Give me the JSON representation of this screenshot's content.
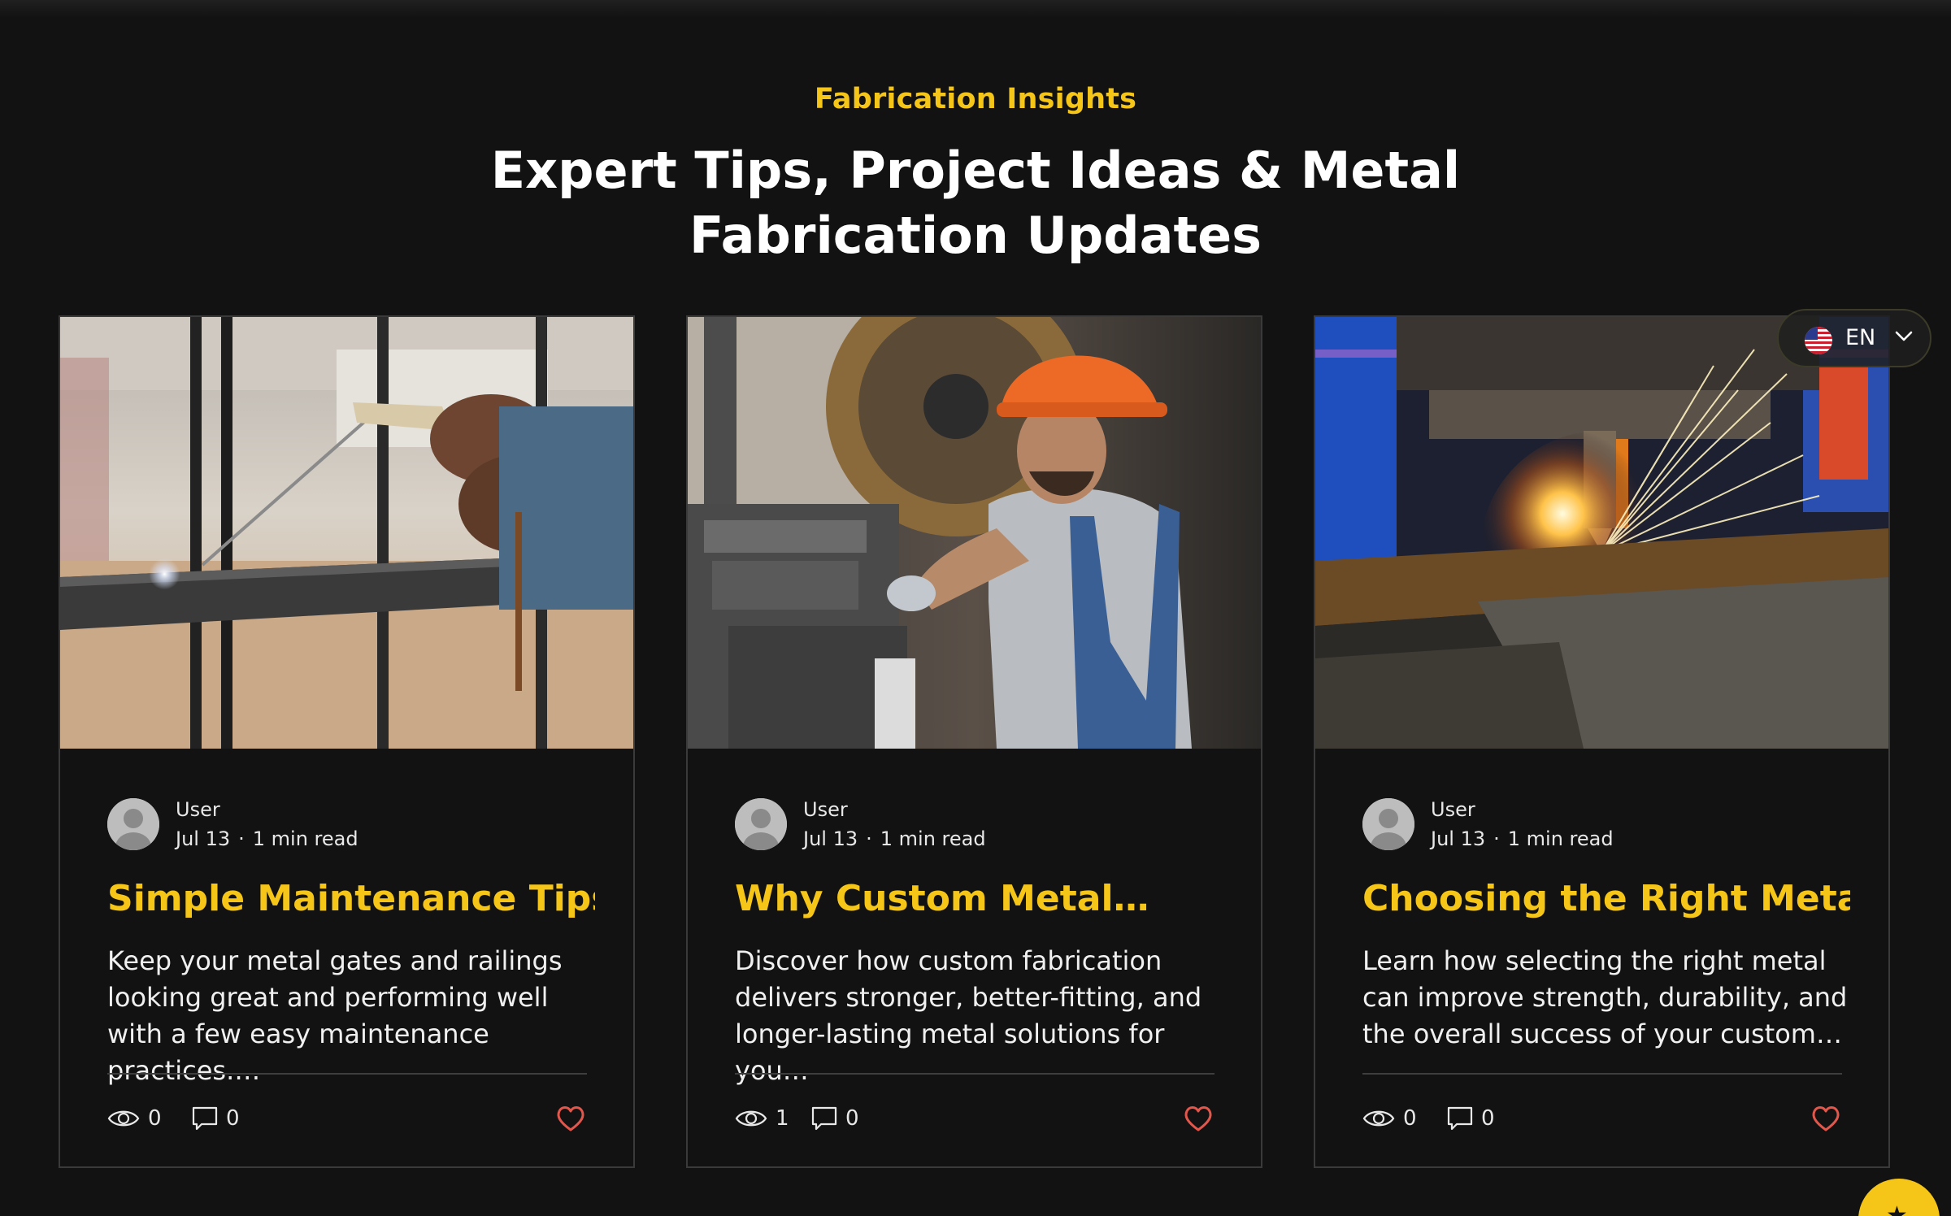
{
  "section": {
    "eyebrow": "Fabrication Insights",
    "headline_line1": "Expert Tips, Project Ideas & Metal",
    "headline_line2": "Fabrication Updates"
  },
  "posts": [
    {
      "author": "User",
      "date": "Jul 13",
      "separator": "·",
      "read_time": "1 min read",
      "title": "Simple Maintenance Tips…",
      "excerpt": "Keep your metal gates and railings looking great and performing well with a few easy maintenance practices.…",
      "views": "0",
      "comments": "0",
      "image_subject": "welding-gate-photo"
    },
    {
      "author": "User",
      "date": "Jul 13",
      "separator": "·",
      "read_time": "1 min read",
      "title": "Why Custom Metal…",
      "excerpt": "Discover how custom fabrication delivers stronger, better-fitting, and longer-lasting metal solutions for you…",
      "views": "1",
      "comments": "0",
      "image_subject": "worker-hard-hat-photo"
    },
    {
      "author": "User",
      "date": "Jul 13",
      "separator": "·",
      "read_time": "1 min read",
      "title": "Choosing the Right Metal…",
      "excerpt": "Learn how selecting the right metal can improve strength, durability, and the overall success of your custom…",
      "views": "0",
      "comments": "0",
      "image_subject": "plasma-cutting-sparks-photo"
    }
  ],
  "language": {
    "label": "EN",
    "flag": "us-flag-icon"
  },
  "colors": {
    "background": "#121212",
    "accent": "#f5c518",
    "text": "#ffffff",
    "like": "#e2574c",
    "card_border": "#3a3a3a"
  }
}
